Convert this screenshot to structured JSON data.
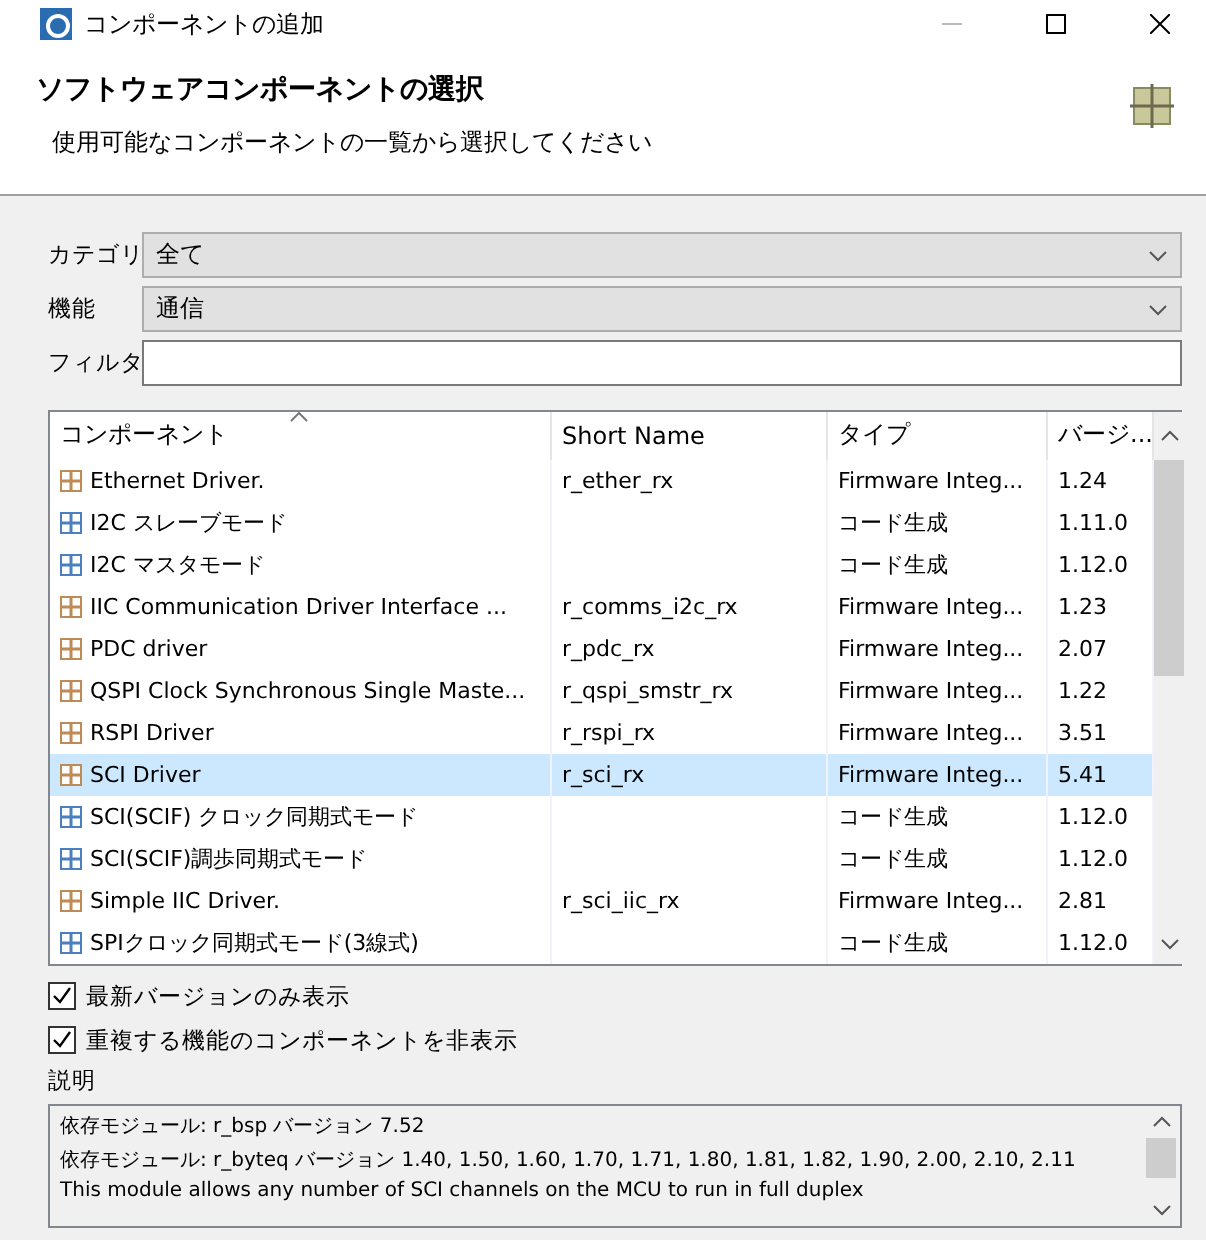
{
  "window": {
    "title": "コンポーネントの追加"
  },
  "header": {
    "title": "ソフトウェアコンポーネントの選択",
    "subtitle": "使用可能なコンポーネントの一覧から選択してください"
  },
  "form": {
    "category": {
      "label": "カテゴリ",
      "value": "全て"
    },
    "function": {
      "label": "機能",
      "value": "通信"
    },
    "filter": {
      "label": "フィルタ"
    }
  },
  "table": {
    "columns": [
      "コンポーネント",
      "Short Name",
      "タイプ",
      "バージ..."
    ],
    "rows": [
      {
        "kind": "fit",
        "name": "Ethernet Driver.",
        "short_name": "r_ether_rx",
        "type": "Firmware Integ...",
        "version": "1.24",
        "selected": false
      },
      {
        "kind": "codegen",
        "name": "I2C スレーブモード",
        "short_name": "",
        "type": "コード生成",
        "version": "1.11.0",
        "selected": false
      },
      {
        "kind": "codegen",
        "name": "I2C マスタモード",
        "short_name": "",
        "type": "コード生成",
        "version": "1.12.0",
        "selected": false
      },
      {
        "kind": "fit",
        "name": "IIC Communication Driver Interface ...",
        "short_name": "r_comms_i2c_rx",
        "type": "Firmware Integ...",
        "version": "1.23",
        "selected": false
      },
      {
        "kind": "fit",
        "name": "PDC driver",
        "short_name": "r_pdc_rx",
        "type": "Firmware Integ...",
        "version": "2.07",
        "selected": false
      },
      {
        "kind": "fit",
        "name": "QSPI Clock Synchronous Single Maste...",
        "short_name": "r_qspi_smstr_rx",
        "type": "Firmware Integ...",
        "version": "1.22",
        "selected": false
      },
      {
        "kind": "fit",
        "name": "RSPI Driver",
        "short_name": "r_rspi_rx",
        "type": "Firmware Integ...",
        "version": "3.51",
        "selected": false
      },
      {
        "kind": "fit",
        "name": "SCI Driver",
        "short_name": "r_sci_rx",
        "type": "Firmware Integ...",
        "version": "5.41",
        "selected": true
      },
      {
        "kind": "codegen",
        "name": "SCI(SCIF) クロック同期式モード",
        "short_name": "",
        "type": "コード生成",
        "version": "1.12.0",
        "selected": false
      },
      {
        "kind": "codegen",
        "name": "SCI(SCIF)調歩同期式モード",
        "short_name": "",
        "type": "コード生成",
        "version": "1.12.0",
        "selected": false
      },
      {
        "kind": "fit",
        "name": "Simple IIC Driver.",
        "short_name": "r_sci_iic_rx",
        "type": "Firmware Integ...",
        "version": "2.81",
        "selected": false
      },
      {
        "kind": "codegen",
        "name": "SPIクロック同期式モード(3線式)",
        "short_name": "",
        "type": "コード生成",
        "version": "1.12.0",
        "selected": false
      }
    ]
  },
  "options": [
    {
      "label": "最新バージョンのみ表示",
      "checked": true
    },
    {
      "label": "重複する機能のコンポーネントを非表示",
      "checked": true
    }
  ],
  "description": {
    "label": "説明",
    "lines": [
      "依存モジュール: r_bsp バージョン 7.52",
      "依存モジュール: r_byteq バージョン 1.40, 1.50, 1.60, 1.70, 1.71, 1.80, 1.81, 1.82, 1.90, 2.00, 2.10, 2.11",
      "This module allows any number of SCI channels on the MCU to run in full duplex"
    ]
  }
}
